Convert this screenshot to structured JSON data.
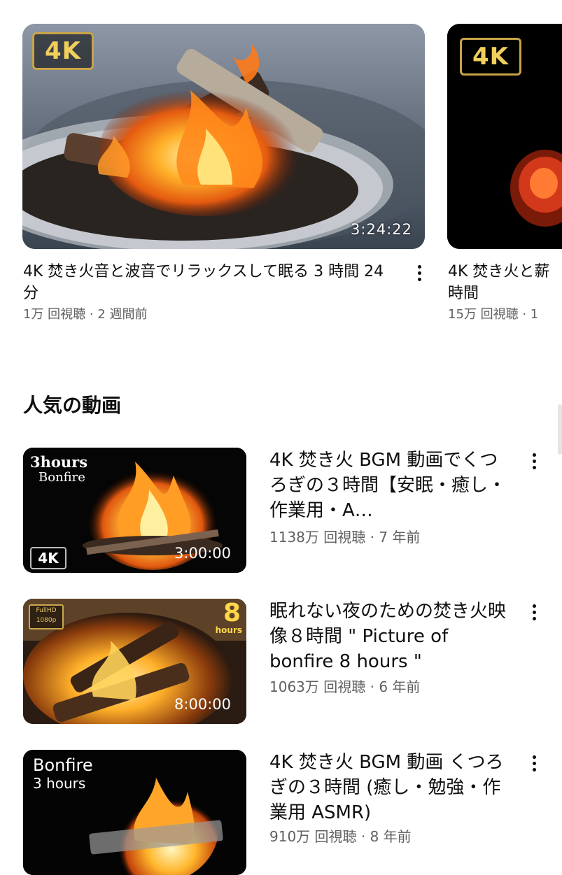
{
  "shelf": {
    "videos": [
      {
        "badge": "4K",
        "duration": "3:24:22",
        "title": "4K 焚き火音と波音でリラックスして眠る 3 時間 24 分",
        "meta": "1万 回視聴 · 2 週間前"
      },
      {
        "badge": "4K",
        "title": "4K 焚き火と薪",
        "title_line2": "時間",
        "meta": "15万 回視聴 · 1"
      }
    ]
  },
  "section": {
    "title": "人気の動画"
  },
  "list": [
    {
      "thumb_line1": "3hours",
      "thumb_line2": "Bonfire",
      "badge": "4K",
      "duration": "3:00:00",
      "title": "4K 焚き火 BGM 動画でくつろぎの３時間【安眠・癒し・作業用・A…",
      "meta": "1138万 回視聴 · 7 年前"
    },
    {
      "hd_badge_top": "FullHD",
      "hd_badge_bottom": "1080p",
      "hours_num": "8",
      "hours_label": "hours",
      "duration": "8:00:00",
      "title": "眠れない夜のための焚き火映像８時間 \" Picture of bonfire 8 hours \"",
      "meta": "1063万 回視聴 · 6 年前"
    },
    {
      "thumb_line1": "Bonfire",
      "thumb_line2": "3 hours",
      "title": "4K 焚き火 BGM 動画 くつろぎの３時間 (癒し・勉強・作業用 ASMR)",
      "meta": "910万 回視聴 · 8 年前"
    }
  ],
  "colors": {
    "background": "#ffffff",
    "text_primary": "#0f0f0f",
    "text_secondary": "#606060",
    "badge_gold": "#f1cf5b"
  },
  "icons": [
    "more-vert-icon",
    "4k-badge-icon",
    "fullhd-badge-icon"
  ]
}
